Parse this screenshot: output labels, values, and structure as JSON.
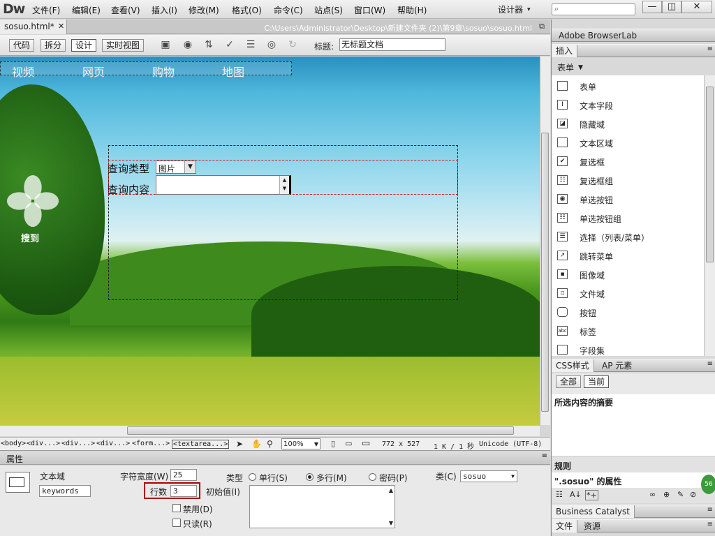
{
  "app": {
    "logo": "Dw",
    "menu": [
      "文件(F)",
      "编辑(E)",
      "查看(V)",
      "插入(I)",
      "修改(M)",
      "格式(O)",
      "命令(C)",
      "站点(S)",
      "窗口(W)",
      "帮助(H)"
    ],
    "workspace": "设计器",
    "window_controls": [
      "—",
      "◫",
      "✕"
    ]
  },
  "document": {
    "tab_name": "sosuo.html*",
    "path": "C:\\Users\\Administrator\\Desktop\\新建文件夹 (2)\\第9章\\sosuo\\sosuo.html",
    "view_buttons": [
      "代码",
      "拆分",
      "设计",
      "实时视图"
    ],
    "title_label": "标题:",
    "title_value": "无标题文档"
  },
  "canvas": {
    "nav": [
      "视频",
      "网页",
      "购物",
      "地图"
    ],
    "brand": "搜到",
    "form": {
      "type_label": "查询类型",
      "type_value": "图片",
      "content_label": "查询内容"
    }
  },
  "status": {
    "tags": [
      "<body>",
      "<div...>",
      "<div...>",
      "<div...>",
      "<form...>",
      "<textarea...>"
    ],
    "zoom": "100%",
    "size": "772 x 527",
    "weight": "1 K / 1 秒",
    "encoding": "Unicode (UTF-8)"
  },
  "properties": {
    "header": "属性",
    "object_label": "文本域",
    "name_value": "keywords",
    "width_label": "字符宽度(W)",
    "width_value": "25",
    "rows_label": "行数",
    "rows_value": "3",
    "type_label": "类型",
    "type_options": [
      "单行(S)",
      "多行(M)",
      "密码(P)"
    ],
    "type_selected": "多行(M)",
    "init_label": "初始值(I)",
    "class_label": "类(C)",
    "class_value": "sosuo",
    "disabled_label": "禁用(D)",
    "readonly_label": "只读(R)"
  },
  "right_panel": {
    "browserlab": "Adobe BrowserLab",
    "insert_tab": "插入",
    "category": "表单",
    "items": [
      "表单",
      "文本字段",
      "隐藏域",
      "文本区域",
      "复选框",
      "复选框组",
      "单选按钮",
      "单选按钮组",
      "选择（列表/菜单）",
      "跳转菜单",
      "图像域",
      "文件域",
      "按钮",
      "标签",
      "字段集"
    ],
    "css_tabs": [
      "CSS样式",
      "AP 元素"
    ],
    "css_mode": [
      "全部",
      "当前"
    ],
    "summary_title": "所选内容的摘要",
    "rules_title": "规则",
    "prop_title": "\".sosuo\" 的属性",
    "business_catalyst": "Business Catalyst",
    "bottom_tabs": [
      "文件",
      "资源"
    ],
    "badge": "56"
  }
}
